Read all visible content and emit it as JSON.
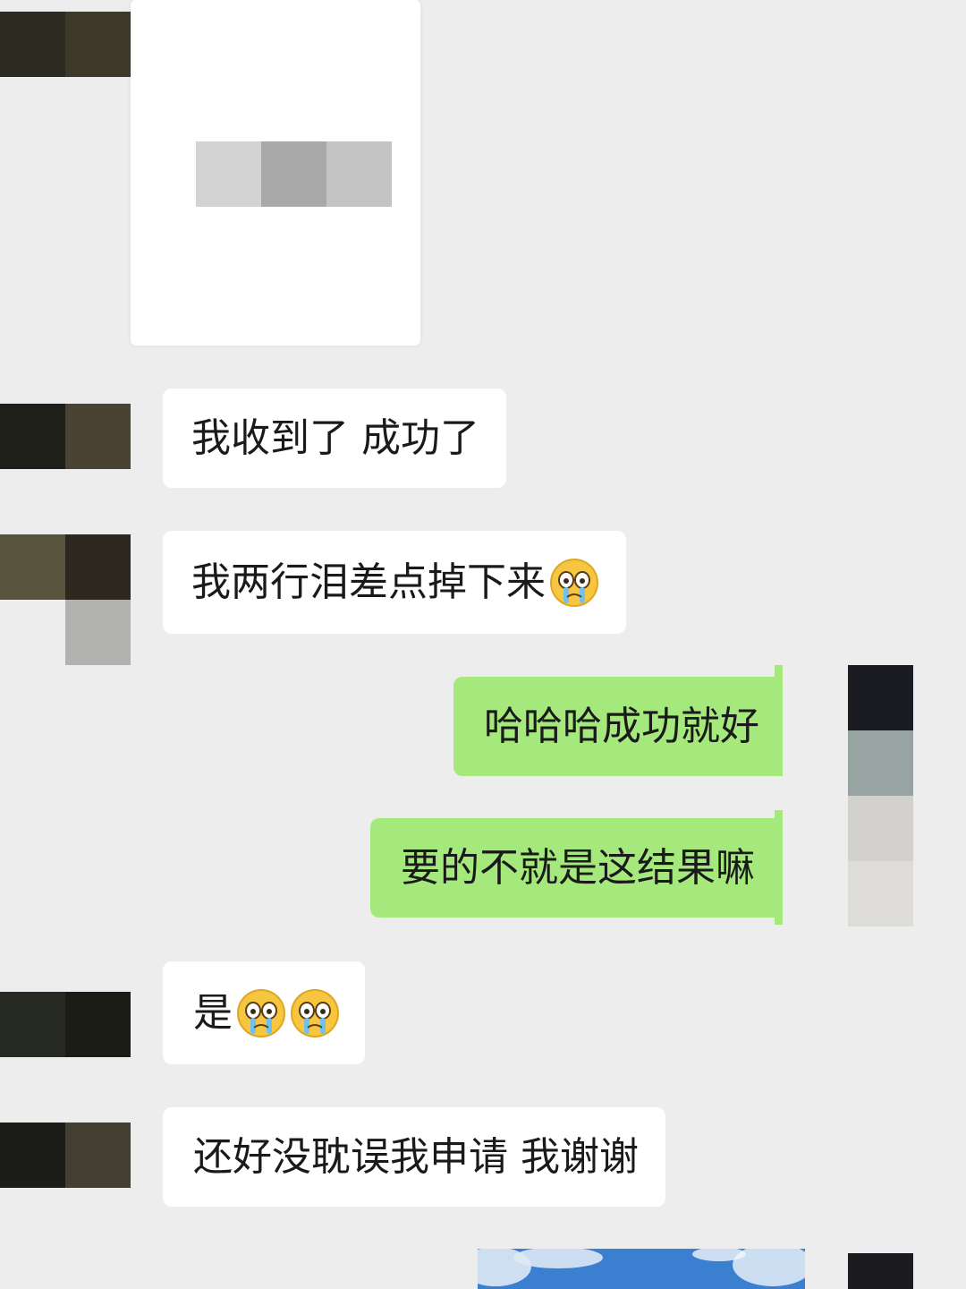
{
  "colors": {
    "background": "#ededed",
    "incoming_bubble": "#ffffff",
    "outgoing_bubble": "#a5e97d",
    "text": "#1a1a1a"
  },
  "messages": [
    {
      "side": "in",
      "type": "image",
      "description_icon": "blurred-document-image"
    },
    {
      "side": "in",
      "type": "text",
      "text": "我收到了 成功了"
    },
    {
      "side": "in",
      "type": "text",
      "text": "我两行泪差点掉下来",
      "emoji": [
        "crying-emoji"
      ]
    },
    {
      "side": "out",
      "type": "text",
      "text": "哈哈哈成功就好"
    },
    {
      "side": "out",
      "type": "text",
      "text": "要的不就是这结果嘛"
    },
    {
      "side": "in",
      "type": "text",
      "text": "是",
      "emoji": [
        "crying-emoji",
        "crying-emoji"
      ]
    },
    {
      "side": "in",
      "type": "text",
      "text": "还好没耽误我申请 我谢谢"
    },
    {
      "side": "out",
      "type": "image",
      "description_icon": "sky-photo"
    }
  ]
}
